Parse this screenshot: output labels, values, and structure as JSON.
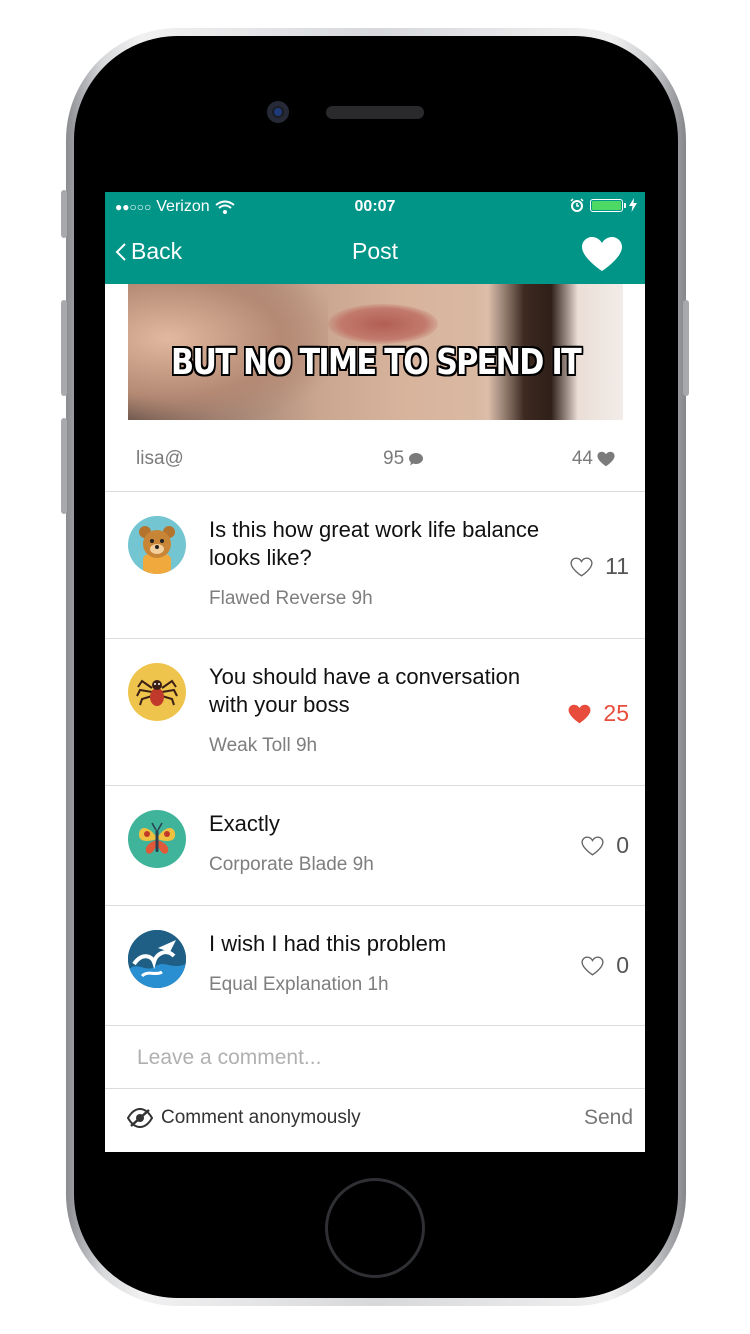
{
  "status_bar": {
    "signal": "●●○○○",
    "carrier": "Verizon",
    "time": "00:07",
    "battery_color": "#4cd964"
  },
  "nav": {
    "back_label": "Back",
    "title": "Post",
    "heart_icon": "heart-icon"
  },
  "post": {
    "image_caption": "BUT NO TIME TO SPEND IT",
    "author": "lisa@",
    "comment_count": "95",
    "like_count": "44"
  },
  "comments": [
    {
      "text": "Is this how great work life balance looks like?",
      "author_time": "Flawed Reverse 9h",
      "likes": "11",
      "liked": false,
      "avatar": "bear-avatar",
      "avatar_color": "#73c5d2"
    },
    {
      "text": "You should have a conversation with your boss",
      "author_time": "Weak Toll 9h",
      "likes": "25",
      "liked": true,
      "avatar": "spider-avatar",
      "avatar_color": "#efc44c"
    },
    {
      "text": "Exactly",
      "author_time": "Corporate Blade 9h",
      "likes": "0",
      "liked": false,
      "avatar": "butterfly-avatar",
      "avatar_color": "#3fb49a"
    },
    {
      "text": "I wish I had this problem",
      "author_time": "Equal Explanation 1h",
      "likes": "0",
      "liked": false,
      "avatar": "wave-avatar",
      "avatar_color": "#1f5f86"
    }
  ],
  "composer": {
    "placeholder": "Leave a comment...",
    "anonymous_label": "Comment anonymously",
    "send_label": "Send"
  },
  "colors": {
    "primary": "#009587",
    "liked": "#e74c3c"
  }
}
